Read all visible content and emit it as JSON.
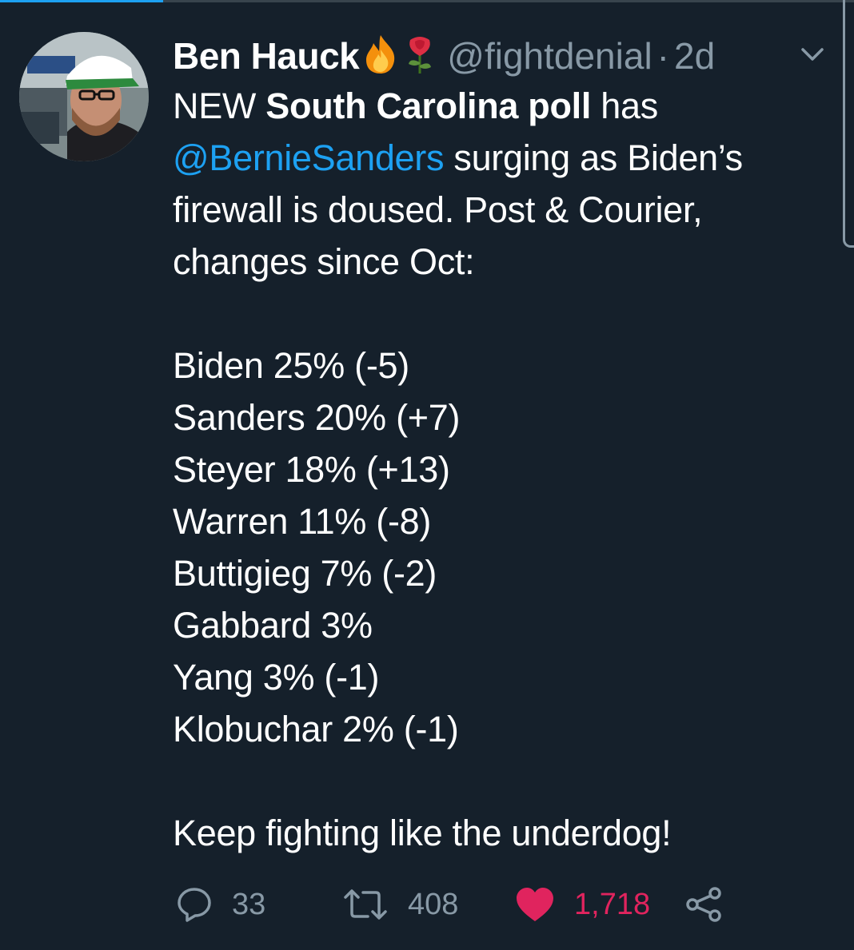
{
  "colors": {
    "background": "#15202b",
    "accent": "#1da1f2",
    "secondary_text": "#8899a6",
    "like": "#e0245e"
  },
  "tweet": {
    "author": {
      "display_name": "Ben Hauck",
      "emojis": [
        "fire-emoji",
        "rose-emoji"
      ],
      "handle": "@fightdenial",
      "separator": "·",
      "time_ago": "2d"
    },
    "text": {
      "intro_prefix": "NEW ",
      "intro_bold": "South Carolina poll",
      "intro_suffix": " has",
      "mention": "@BernieSanders",
      "after_mention": " surging as Biden’s",
      "line3": "firewall is doused. Post & Courier,",
      "line4": "changes since Oct:",
      "poll_lines": [
        "Biden 25% (-5)",
        "Sanders 20% (+7)",
        "Steyer 18% (+13)",
        "Warren 11% (-8)",
        "Buttigieg 7% (-2)",
        "Gabbard 3%",
        "Yang 3% (-1)",
        "Klobuchar 2% (-1)"
      ],
      "closing": "Keep fighting like the underdog!"
    },
    "actions": {
      "replies": "33",
      "retweets": "408",
      "likes": "1,718",
      "icons": [
        "reply-icon",
        "retweet-icon",
        "heart-icon",
        "share-icon"
      ]
    }
  }
}
